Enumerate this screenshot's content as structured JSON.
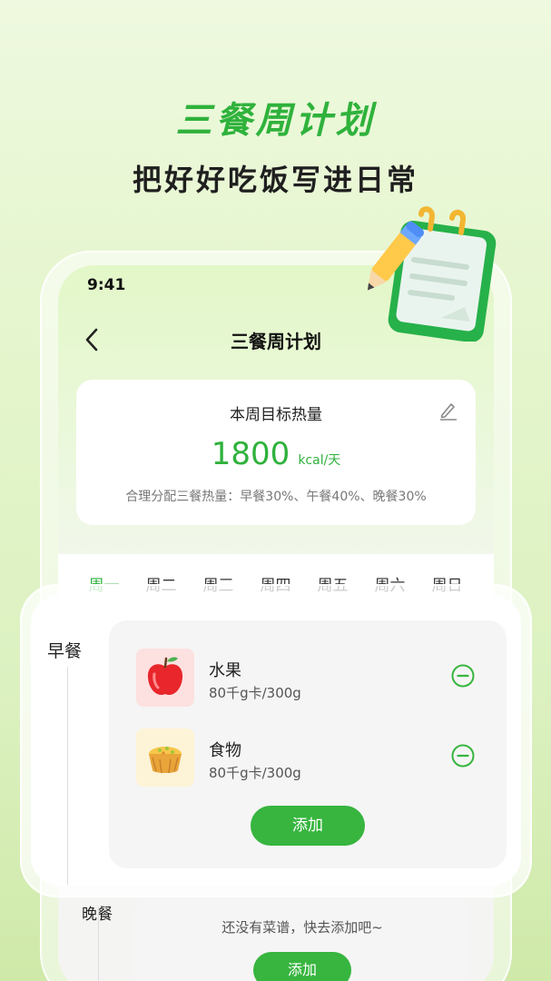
{
  "hero": {
    "title": "三餐周计划",
    "subtitle": "把好好吃饭写进日常"
  },
  "status_bar": {
    "time": "9:41"
  },
  "nav": {
    "title": "三餐周计划"
  },
  "calorie_card": {
    "title": "本周目标热量",
    "value": "1800",
    "unit": "kcal/天",
    "description": "合理分配三餐热量：早餐30%、午餐40%、晚餐30%"
  },
  "tabs": [
    "周一",
    "周二",
    "周三",
    "周四",
    "周五",
    "周六",
    "周日"
  ],
  "active_tab_index": 0,
  "breakfast": {
    "label": "早餐",
    "items": [
      {
        "name": "水果",
        "calories": "80千g卡/300g",
        "icon": "apple-icon"
      },
      {
        "name": "食物",
        "calories": "80千g卡/300g",
        "icon": "tart-icon"
      }
    ],
    "add_label": "添加"
  },
  "dinner": {
    "label": "晚餐",
    "empty_text": "还没有菜谱，快去添加吧~",
    "add_label": "添加"
  },
  "colors": {
    "accent": "#2fb23c",
    "button": "#37b53f"
  }
}
